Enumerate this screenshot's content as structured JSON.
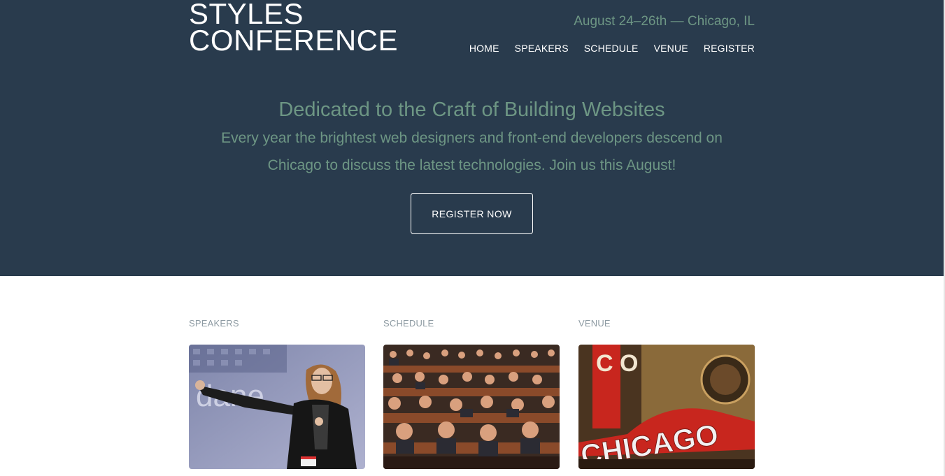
{
  "site": {
    "logo_line1": "STYLES",
    "logo_line2": "CONFERENCE",
    "event_info": "August 24–26th — Chicago, IL"
  },
  "nav": {
    "items": [
      "HOME",
      "SPEAKERS",
      "SCHEDULE",
      "VENUE",
      "REGISTER"
    ]
  },
  "hero": {
    "tagline": "Dedicated to the Craft of Building Websites",
    "intro": "Every year the brightest web designers and front-end developers descend on Chicago to discuss the latest technologies. Join us this August!",
    "cta_label": "REGISTER NOW"
  },
  "teasers": [
    {
      "heading": "SPEAKERS",
      "image": "speaker-presenting-photo"
    },
    {
      "heading": "SCHEDULE",
      "image": "audience-in-theater-photo"
    },
    {
      "heading": "VENUE",
      "image": "chicago-theater-sign-photo"
    }
  ],
  "photo_texts": {
    "speaker_screen": "dane",
    "venue_sign": "CHICAGO",
    "venue_vertical": "C O"
  },
  "colors": {
    "header_bg": "#293b4d",
    "accent_green": "#6d9684",
    "heading_gray": "#8e9ba3"
  }
}
